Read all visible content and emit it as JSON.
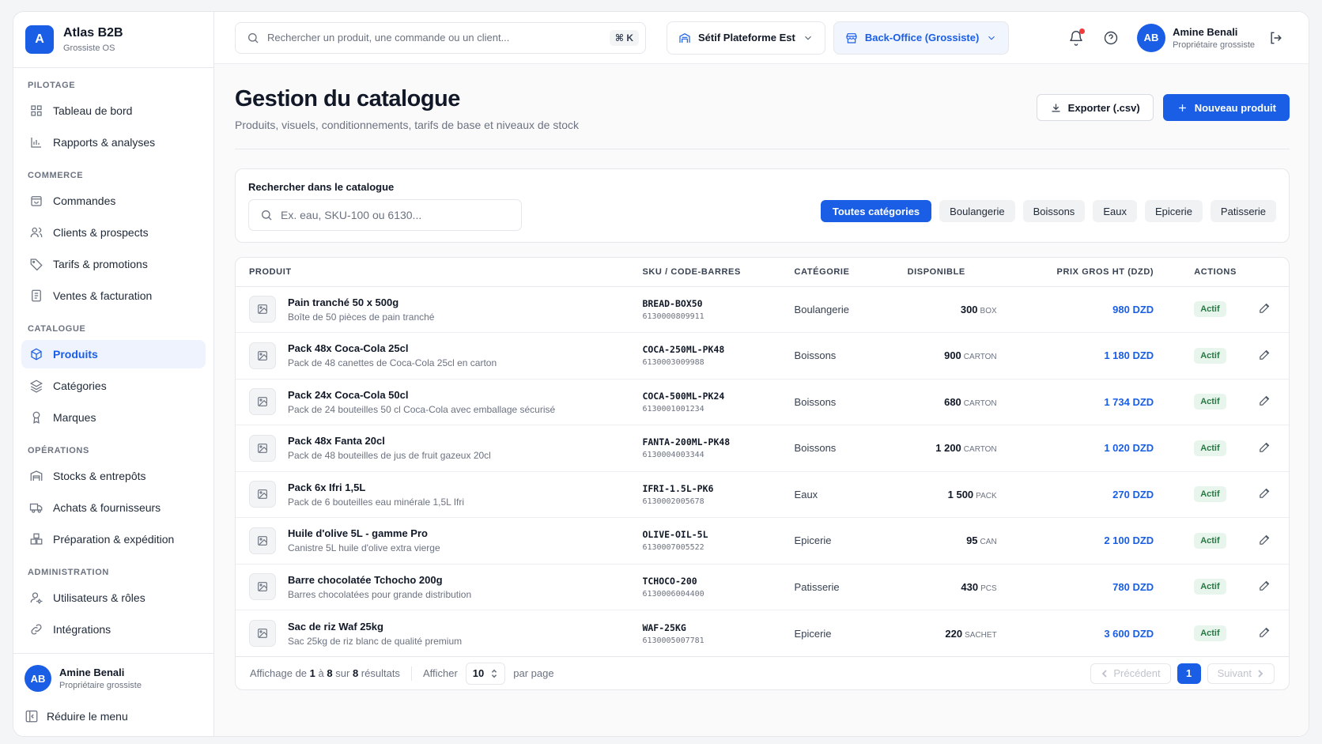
{
  "brand": {
    "logo": "A",
    "name": "Atlas B2B",
    "subtitle": "Grossiste OS"
  },
  "sidebar": {
    "sections": [
      {
        "title": "PILOTAGE",
        "items": [
          {
            "label": "Tableau de bord",
            "icon": "grid-icon"
          },
          {
            "label": "Rapports & analyses",
            "icon": "bar-chart-icon"
          }
        ]
      },
      {
        "title": "COMMERCE",
        "items": [
          {
            "label": "Commandes",
            "icon": "bag-icon"
          },
          {
            "label": "Clients & prospects",
            "icon": "users-icon"
          },
          {
            "label": "Tarifs & promotions",
            "icon": "tag-icon"
          },
          {
            "label": "Ventes & facturation",
            "icon": "invoice-icon"
          }
        ]
      },
      {
        "title": "CATALOGUE",
        "items": [
          {
            "label": "Produits",
            "icon": "box-icon",
            "active": true
          },
          {
            "label": "Catégories",
            "icon": "layers-icon"
          },
          {
            "label": "Marques",
            "icon": "award-icon"
          }
        ]
      },
      {
        "title": "OPÉRATIONS",
        "items": [
          {
            "label": "Stocks & entrepôts",
            "icon": "warehouse-icon"
          },
          {
            "label": "Achats & fournisseurs",
            "icon": "truck-icon"
          },
          {
            "label": "Préparation & expédition",
            "icon": "boxes-icon"
          }
        ]
      },
      {
        "title": "ADMINISTRATION",
        "items": [
          {
            "label": "Utilisateurs & rôles",
            "icon": "user-cog-icon"
          },
          {
            "label": "Intégrations",
            "icon": "link-icon"
          }
        ]
      }
    ],
    "user": {
      "initials": "AB",
      "name": "Amine Benali",
      "role": "Propriétaire grossiste"
    },
    "collapse_label": "Réduire le menu"
  },
  "topbar": {
    "search_placeholder": "Rechercher un produit, une commande ou un client...",
    "shortcut": "⌘ K",
    "warehouse": "Sétif Plateforme Est",
    "workspace": "Back-Office (Grossiste)",
    "user": {
      "initials": "AB",
      "name": "Amine Benali",
      "role": "Propriétaire grossiste"
    }
  },
  "page": {
    "title": "Gestion du catalogue",
    "subtitle": "Produits, visuels, conditionnements, tarifs de base et niveaux de stock",
    "export_label": "Exporter (.csv)",
    "new_label": "Nouveau produit"
  },
  "filters": {
    "label": "Rechercher dans le catalogue",
    "placeholder": "Ex. eau, SKU-100 ou 6130...",
    "categories": [
      {
        "label": "Toutes catégories",
        "active": true
      },
      {
        "label": "Boulangerie"
      },
      {
        "label": "Boissons"
      },
      {
        "label": "Eaux"
      },
      {
        "label": "Epicerie"
      },
      {
        "label": "Patisserie"
      }
    ]
  },
  "table": {
    "columns": {
      "product": "PRODUIT",
      "sku": "SKU / CODE-BARRES",
      "category": "CATÉGORIE",
      "available": "DISPONIBLE",
      "price": "PRIX GROS HT (DZD)",
      "actions": "ACTIONS"
    },
    "rows": [
      {
        "name": "Pain tranché 50 x 500g",
        "desc": "Boîte de 50 pièces de pain tranché",
        "sku": "BREAD-BOX50",
        "barcode": "6130000809911",
        "category": "Boulangerie",
        "qty": "300",
        "unit": "BOX",
        "price": "980 DZD",
        "status": "Actif"
      },
      {
        "name": "Pack 48x Coca-Cola 25cl",
        "desc": "Pack de 48 canettes de Coca-Cola 25cl en carton",
        "sku": "COCA-250ML-PK48",
        "barcode": "6130003009988",
        "category": "Boissons",
        "qty": "900",
        "unit": "CARTON",
        "price": "1 180 DZD",
        "status": "Actif"
      },
      {
        "name": "Pack 24x Coca-Cola 50cl",
        "desc": "Pack de 24 bouteilles 50 cl Coca-Cola avec emballage sécurisé",
        "sku": "COCA-500ML-PK24",
        "barcode": "6130001001234",
        "category": "Boissons",
        "qty": "680",
        "unit": "CARTON",
        "price": "1 734 DZD",
        "status": "Actif"
      },
      {
        "name": "Pack 48x Fanta 20cl",
        "desc": "Pack de 48 bouteilles de jus de fruit gazeux 20cl",
        "sku": "FANTA-200ML-PK48",
        "barcode": "6130004003344",
        "category": "Boissons",
        "qty": "1 200",
        "unit": "CARTON",
        "price": "1 020 DZD",
        "status": "Actif"
      },
      {
        "name": "Pack 6x Ifri 1,5L",
        "desc": "Pack de 6 bouteilles eau minérale 1,5L Ifri",
        "sku": "IFRI-1.5L-PK6",
        "barcode": "6130002005678",
        "category": "Eaux",
        "qty": "1 500",
        "unit": "PACK",
        "price": "270 DZD",
        "status": "Actif"
      },
      {
        "name": "Huile d'olive 5L - gamme Pro",
        "desc": "Canistre 5L huile d'olive extra vierge",
        "sku": "OLIVE-OIL-5L",
        "barcode": "6130007005522",
        "category": "Epicerie",
        "qty": "95",
        "unit": "CAN",
        "price": "2 100 DZD",
        "status": "Actif"
      },
      {
        "name": "Barre chocolatée Tchocho 200g",
        "desc": "Barres chocolatées pour grande distribution",
        "sku": "TCHOCO-200",
        "barcode": "6130006004400",
        "category": "Patisserie",
        "qty": "430",
        "unit": "PCS",
        "price": "780 DZD",
        "status": "Actif"
      },
      {
        "name": "Sac de riz Waf 25kg",
        "desc": "Sac 25kg de riz blanc de qualité premium",
        "sku": "WAF-25KG",
        "barcode": "6130005007781",
        "category": "Epicerie",
        "qty": "220",
        "unit": "SACHET",
        "price": "3 600 DZD",
        "status": "Actif"
      }
    ]
  },
  "pager": {
    "prefix": "Affichage de",
    "from": "1",
    "to_word": "à",
    "to": "8",
    "of_word": "sur",
    "total": "8",
    "suffix": "résultats",
    "show_label": "Afficher",
    "per_page": "10",
    "per_page_suffix": "par page",
    "prev": "Précédent",
    "page": "1",
    "next": "Suivant"
  },
  "colors": {
    "accent": "#1a5ee6",
    "status_bg": "#e8f5ec",
    "status_text": "#247a42",
    "notification": "#ef3b3b"
  }
}
